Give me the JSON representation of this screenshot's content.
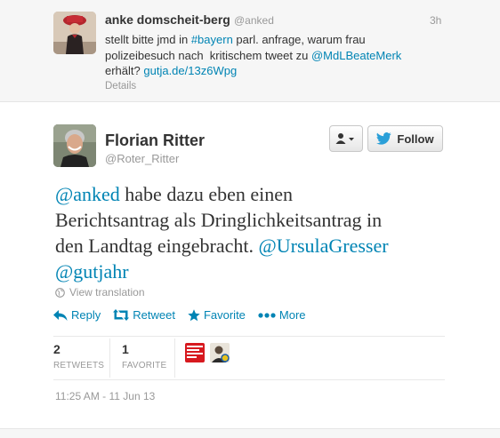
{
  "parent_tweet": {
    "name": "anke domscheit-berg",
    "handle": "@anked",
    "time": "3h",
    "line1_pre": "stellt bitte jmd in ",
    "hashtag": "#bayern",
    "line1_post": " parl. anfrage, warum frau",
    "line2_pre": "polizeibesuch nach  kritischem tweet zu ",
    "mention": "@MdLBeateMerk",
    "line3_pre": "erhält? ",
    "link": "gutja.de/13z6Wpg",
    "details_label": "Details"
  },
  "tweet": {
    "name": "Florian Ritter",
    "handle": "@Roter_Ritter",
    "follow_label": "Follow",
    "text_mention1": "@anked",
    "text_line1": " habe dazu eben einen",
    "text_line2": "Berichtsantrag als Dringlichkeitsantrag in",
    "text_line3": "den Landtag eingebracht. ",
    "text_mention2": "@UrsulaGresser",
    "text_mention3": "@gutjahr",
    "translate_label": "View translation",
    "timestamp": "11:25 AM - 11 Jun 13"
  },
  "actions": {
    "reply": "Reply",
    "retweet": "Retweet",
    "favorite": "Favorite",
    "more": "More"
  },
  "stats": {
    "retweets_count": "2",
    "retweets_label": "RETWEETS",
    "favorites_count": "1",
    "favorites_label": "FAVORITE"
  },
  "colors": {
    "link": "#0084b4",
    "muted": "#999999",
    "text": "#333333"
  }
}
